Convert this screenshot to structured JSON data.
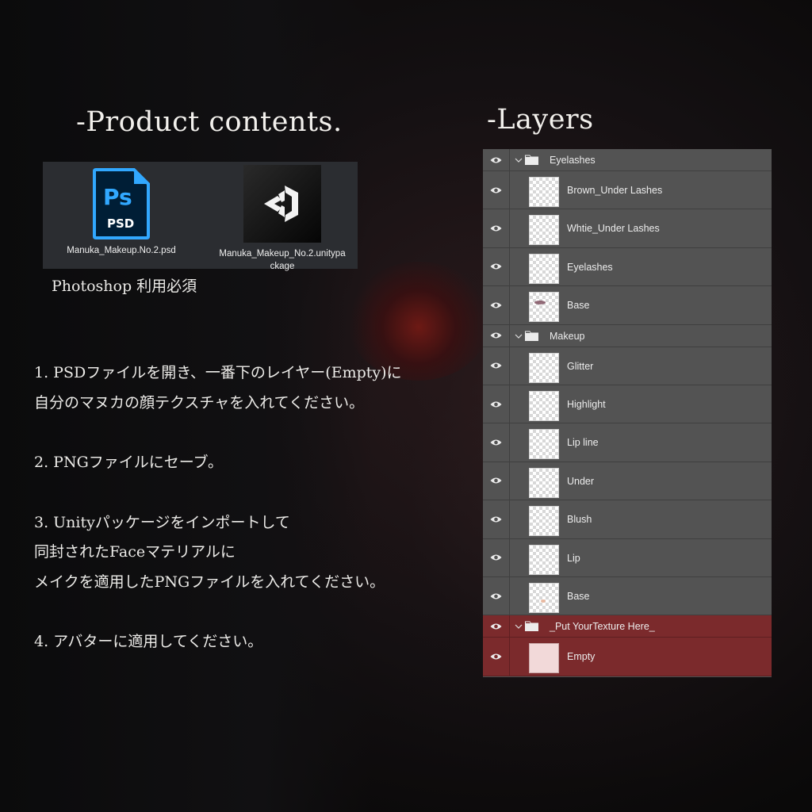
{
  "headings": {
    "product": "-Product contents.",
    "layers": "-Layers"
  },
  "files": [
    {
      "name": "Manuka_Makeup.No.2.psd",
      "icon": "photoshop-psd-icon",
      "icon_text_top": "Ps",
      "icon_text_bottom": "PSD"
    },
    {
      "name_line1": "Manuka_Makeup_No.2.unitypa",
      "name_line2": "ckage",
      "icon": "unity-logo-icon"
    }
  ],
  "note": "Photoshop 利用必須",
  "steps": [
    [
      "1. PSDファイルを開き、一番下のレイヤー(Empty)に",
      "自分のマヌカの顔テクスチャを入れてください。"
    ],
    [
      "2. PNGファイルにセーブ。"
    ],
    [
      "3. Unityパッケージをインポートして",
      "同封されたFaceマテリアルに",
      "メイクを適用したPNGファイルを入れてください。"
    ],
    [
      "4. アバターに適用してください。"
    ]
  ],
  "layers": {
    "group1": {
      "name": "Eyelashes",
      "items": [
        "Brown_Under Lashes",
        "Whtie_Under Lashes",
        "Eyelashes",
        "Base"
      ]
    },
    "group2": {
      "name": "Makeup",
      "items": [
        "Glitter",
        "Highlight",
        "Lip line",
        "Under",
        "Blush",
        "Lip",
        "Base"
      ]
    },
    "group3": {
      "name": "_Put YourTexture Here_",
      "items": [
        "Empty"
      ]
    }
  },
  "colors": {
    "panel": "#535353",
    "highlight": "#7b2a2c",
    "psd_blue": "#31a8ff",
    "psd_bg": "#001e36"
  }
}
